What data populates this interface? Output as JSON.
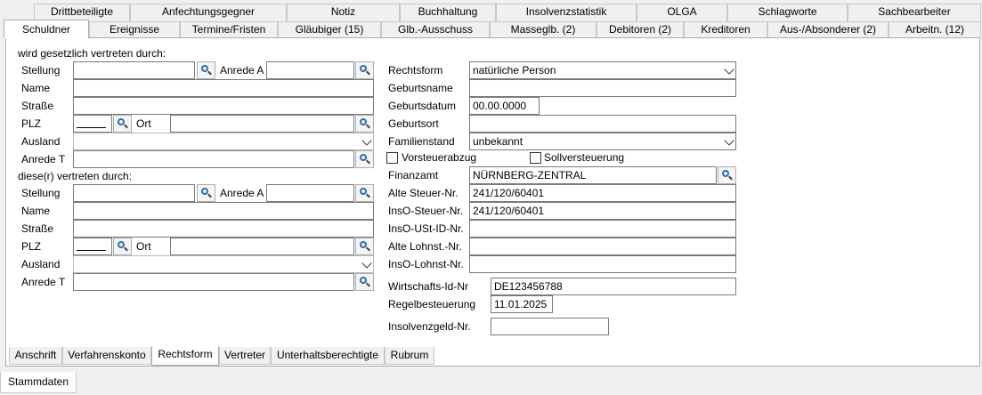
{
  "tabs_row1": [
    "Drittbeteiligte",
    "Anfechtungsgegner",
    "Notiz",
    "Buchhaltung",
    "Insolvenzstatistik",
    "OLGA",
    "Schlagworte",
    "Sachbearbeiter"
  ],
  "tabs_row2": [
    "Schuldner",
    "Ereignisse",
    "Termine/Fristen",
    "Gläubiger (15)",
    "Glb.-Ausschuss",
    "Masseglb. (2)",
    "Debitoren (2)",
    "Kreditoren",
    "Aus-/Absonderer (2)",
    "Arbeitn. (12)"
  ],
  "left": {
    "section1_title": "wird gesetzlich vertreten durch:",
    "section2_title": "diese(r) vertreten durch:",
    "stellung": "Stellung",
    "anrede_a": "Anrede A",
    "name": "Name",
    "strasse": "Straße",
    "plz": "PLZ",
    "ort": "Ort",
    "ausland": "Ausland",
    "anrede_t": "Anrede T"
  },
  "right": {
    "rechtsform_label": "Rechtsform",
    "rechtsform_value": "natürliche Person",
    "geburtsname_label": "Geburtsname",
    "geburtsdatum_label": "Geburtsdatum",
    "geburtsdatum_value": "00.00.0000",
    "geburtsort_label": "Geburtsort",
    "familienstand_label": "Familienstand",
    "familienstand_value": "unbekannt",
    "vorsteuerabzug": "Vorsteuerabzug",
    "sollversteuerung": "Sollversteuerung",
    "finanzamt_label": "Finanzamt",
    "finanzamt_value": "NÜRNBERG-ZENTRAL",
    "alte_steuer_label": "Alte Steuer-Nr.",
    "alte_steuer_value": "241/120/60401",
    "inso_steuer_label": "InsO-Steuer-Nr.",
    "inso_steuer_value": "241/120/60401",
    "inso_ust_label": "InsO-USt-ID-Nr.",
    "alte_lohnst_label": "Alte Lohnst.-Nr.",
    "inso_lohnst_label": "InsO-Lohnst-Nr.",
    "wirtschafts_label": "Wirtschafts-Id-Nr",
    "wirtschafts_value": "DE123456788",
    "regel_label": "Regelbesteuerung",
    "regel_value": "11.01.2025",
    "insolvenzgeld_label": "Insolvenzgeld-Nr."
  },
  "bottom_tabs": [
    "Anschrift",
    "Verfahrenskonto",
    "Rechtsform",
    "Vertreter",
    "Unterhaltsberechtigte",
    "Rubrum"
  ],
  "footer_tab": "Stammdaten"
}
